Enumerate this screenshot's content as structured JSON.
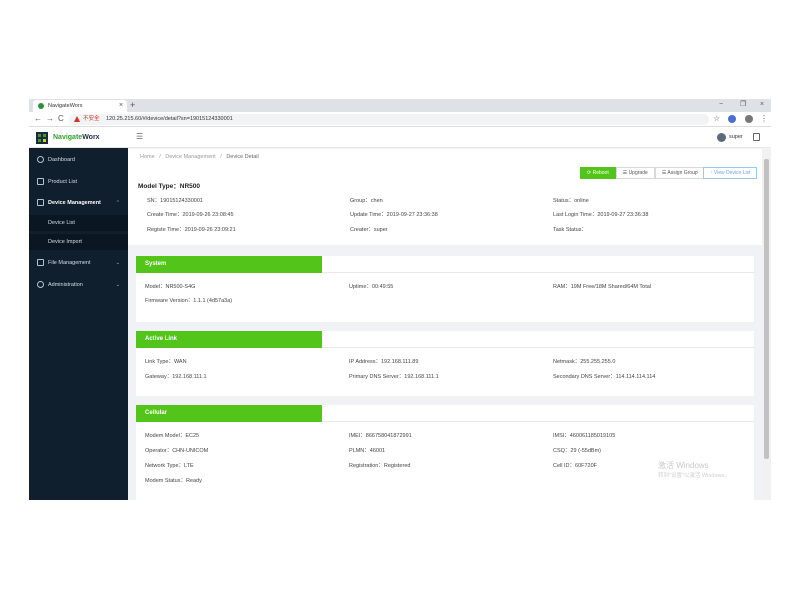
{
  "browser": {
    "tab_title": "NavigateWorx",
    "tab_close": "×",
    "new_tab": "+",
    "minimize": "−",
    "maximize": "❐",
    "close": "×",
    "back": "←",
    "forward": "→",
    "reload": "C",
    "insecure_label": "不安全",
    "url": "120.25.215.60/#/device/detail?sn=19015124330001",
    "star": "☆",
    "menu": "⋮"
  },
  "logo": {
    "part1": "Navigate",
    "part2": "Worx"
  },
  "sidebar": {
    "items": [
      {
        "label": "Dashboard",
        "icon": "dashboard-icon"
      },
      {
        "label": "Product List",
        "icon": "product-icon"
      },
      {
        "label": "Device Management",
        "icon": "device-icon",
        "expanded": true
      },
      {
        "label": "File Management",
        "icon": "folder-icon",
        "collapsed": true
      },
      {
        "label": "Administration",
        "icon": "user-icon",
        "collapsed": true
      }
    ],
    "submenu": [
      {
        "label": "Device List"
      },
      {
        "label": "Device Import"
      }
    ],
    "arrow_up": "⌃",
    "arrow_down": "⌄"
  },
  "topbar": {
    "hamburger": "☰",
    "user": "super"
  },
  "breadcrumb": {
    "home": "Home",
    "sep": "/",
    "mid": "Device Management",
    "current": "Device Detail"
  },
  "actions": {
    "reboot": "⟳ Reboot",
    "upgrade": "☰ Upgrade",
    "assign_group": "☰ Assign Group",
    "view_device_list": "↑ View Device List"
  },
  "device": {
    "model_type": "Model Type：NR500",
    "sn": "SN：19015124330001",
    "group": "Group：chen",
    "status": "Status：online",
    "create_time": "Create Time：2019-09-26 23:08:45",
    "update_time": "Update Time：2019-09-27 23:36:38",
    "last_login_time": "Last Login Time：2019-09-27 23:36:38",
    "register_time": "Registe Time：2019-09-26 23:09:21",
    "creater": "Creater：super",
    "task_status": "Task Status："
  },
  "sections": {
    "system": {
      "title": "System",
      "model": "Model：NR500-S4G",
      "uptime": "Uptime：00:49:55",
      "ram": "RAM：19M Free/18M Shared/64M Total",
      "firmware": "Firmware Version：1.1.1 (4d57a3a)"
    },
    "active_link": {
      "title": "Active Link",
      "link_type": "Link Type：WAN",
      "ip_address": "IP Address：192.168.111.89",
      "netmask": "Netmask：255.255.255.0",
      "gateway": "Gateway：192.168.111.1",
      "primary_dns": "Primary DNS Server：192.168.111.1",
      "secondary_dns": "Secondary DNS Server：114.114.114.114"
    },
    "cellular": {
      "title": "Cellular",
      "modem_model": "Modem Model：EC25",
      "imei": "IMEI：866758041872991",
      "imsi": "IMSI：460061185019105",
      "operator": "Operator：CHN-UNICOM",
      "plmn": "PLMN：46001",
      "csq": "CSQ：29 (-55dBm)",
      "network_type": "Network Type：LTE",
      "registration": "Registration：Registered",
      "cell_id": "Cell ID：60F720F",
      "modem_status": "Modem Status：Ready"
    }
  },
  "watermark": {
    "line1": "激活 Windows",
    "line2": "转到\"设置\"以激活 Windows。"
  },
  "colors": {
    "accent": "#52c41a",
    "sidebar_bg": "#0f1f2d",
    "link": "#6aa7e0"
  }
}
